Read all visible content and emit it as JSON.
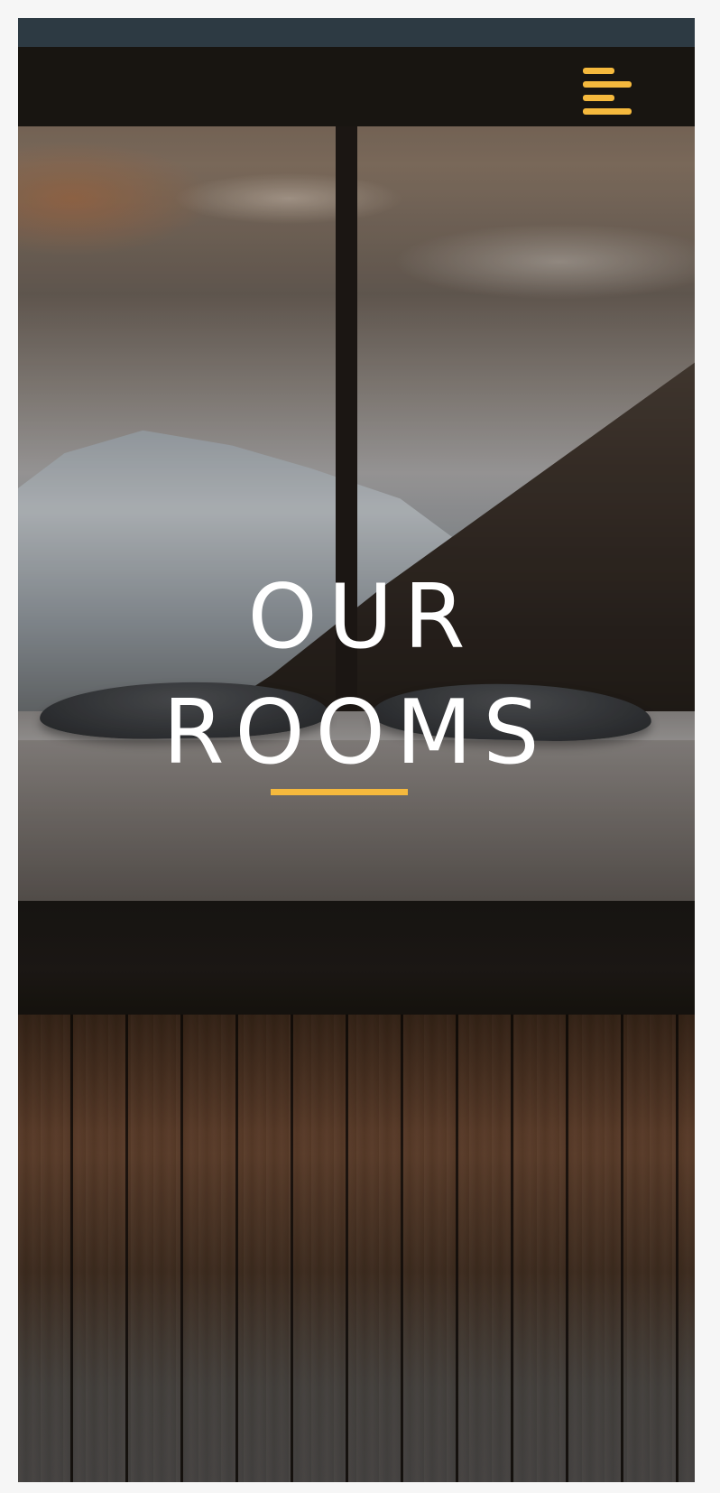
{
  "hero": {
    "title_line1": "OUR",
    "title_line2": "ROOMS",
    "background_image": "bedroom-mountain-view-photo"
  },
  "nav": {
    "menu_icon": "hamburger-menu-icon"
  },
  "colors": {
    "accent": "#f5b93d",
    "title_text": "#ffffff",
    "page_background": "#f6f6f6"
  }
}
